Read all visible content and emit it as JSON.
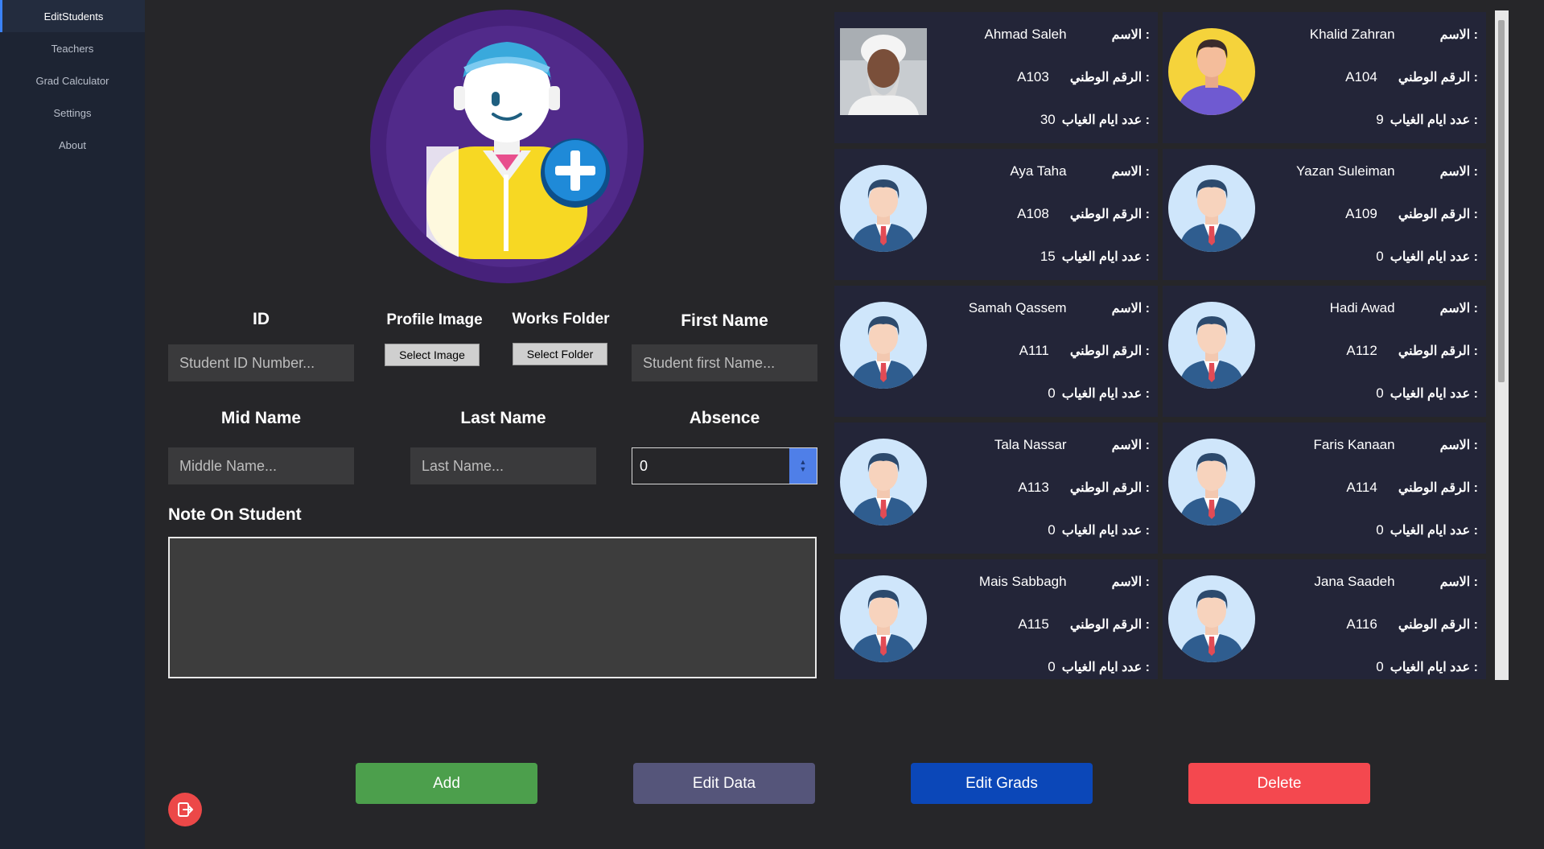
{
  "sidebar": {
    "items": [
      {
        "label": "EditStudents",
        "active": true
      },
      {
        "label": "Teachers"
      },
      {
        "label": "Grad Calculator"
      },
      {
        "label": "Settings"
      },
      {
        "label": "About"
      }
    ]
  },
  "form": {
    "id_label": "ID",
    "id_placeholder": "Student ID Number...",
    "profile_image_label": "Profile Image",
    "select_image_button": "Select Image",
    "works_folder_label": "Works Folder",
    "select_folder_button": "Select Folder",
    "first_name_label": "First Name",
    "first_name_placeholder": "Student first Name...",
    "mid_name_label": "Mid Name",
    "mid_name_placeholder": "Middle Name...",
    "last_name_label": "Last Name",
    "last_name_placeholder": "Last Name...",
    "absence_label": "Absence",
    "absence_value": "0",
    "note_label": "Note On Student",
    "note_value": ""
  },
  "actions": {
    "add": "Add",
    "edit_data": "Edit Data",
    "edit_grads": "Edit Grads",
    "delete": "Delete"
  },
  "card_labels": {
    "name": "الاسم :",
    "national_id": "الرقم الوطني :",
    "absence_days": "عدد ايام الغياب :"
  },
  "students": [
    {
      "name": "Ahmad Saleh",
      "id": "A103",
      "absence": "30",
      "photo": "photo-portrait"
    },
    {
      "name": "Khalid Zahran",
      "id": "A104",
      "absence": "9",
      "photo": "avatar-yellow"
    },
    {
      "name": "Aya Taha",
      "id": "A108",
      "absence": "15",
      "photo": "avatar-default"
    },
    {
      "name": "Yazan Suleiman",
      "id": "A109",
      "absence": "0",
      "photo": "avatar-default"
    },
    {
      "name": "Samah Qassem",
      "id": "A111",
      "absence": "0",
      "photo": "avatar-default"
    },
    {
      "name": "Hadi Awad",
      "id": "A112",
      "absence": "0",
      "photo": "avatar-default"
    },
    {
      "name": "Tala Nassar",
      "id": "A113",
      "absence": "0",
      "photo": "avatar-default"
    },
    {
      "name": "Faris Kanaan",
      "id": "A114",
      "absence": "0",
      "photo": "avatar-default"
    },
    {
      "name": "Mais Sabbagh",
      "id": "A115",
      "absence": "0",
      "photo": "avatar-default"
    },
    {
      "name": "Jana Saadeh",
      "id": "A116",
      "absence": "0",
      "photo": "avatar-default"
    }
  ],
  "colors": {
    "add": "#4c9f4c",
    "edit_data": "#55557a",
    "edit_grads": "#0b47b8",
    "delete": "#f4484f",
    "card_bg": "#232538",
    "app_bg": "#262629"
  }
}
